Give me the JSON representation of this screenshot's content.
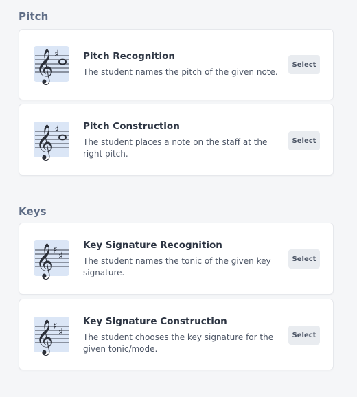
{
  "sections": [
    {
      "heading": "Pitch",
      "cards": [
        {
          "title": "Pitch Recognition",
          "description": "The student names the pitch of the given note.",
          "button": "Select",
          "icon": "treble-clef-note-icon"
        },
        {
          "title": "Pitch Construction",
          "description": "The student places a note on the staff at the right pitch.",
          "button": "Select",
          "icon": "treble-clef-note-icon"
        }
      ]
    },
    {
      "heading": "Keys",
      "cards": [
        {
          "title": "Key Signature Recognition",
          "description": "The student names the tonic of the given key signature.",
          "button": "Select",
          "icon": "treble-clef-key-signature-icon"
        },
        {
          "title": "Key Signature Construction",
          "description": "The student chooses the key signature for the given tonic/mode.",
          "button": "Select",
          "icon": "treble-clef-key-signature-icon"
        }
      ]
    }
  ],
  "colors": {
    "background": "#f5f6f8",
    "heading": "#5f6d86",
    "thumb_bg": "#dbe6f6",
    "button_bg": "#e9ecf0"
  }
}
